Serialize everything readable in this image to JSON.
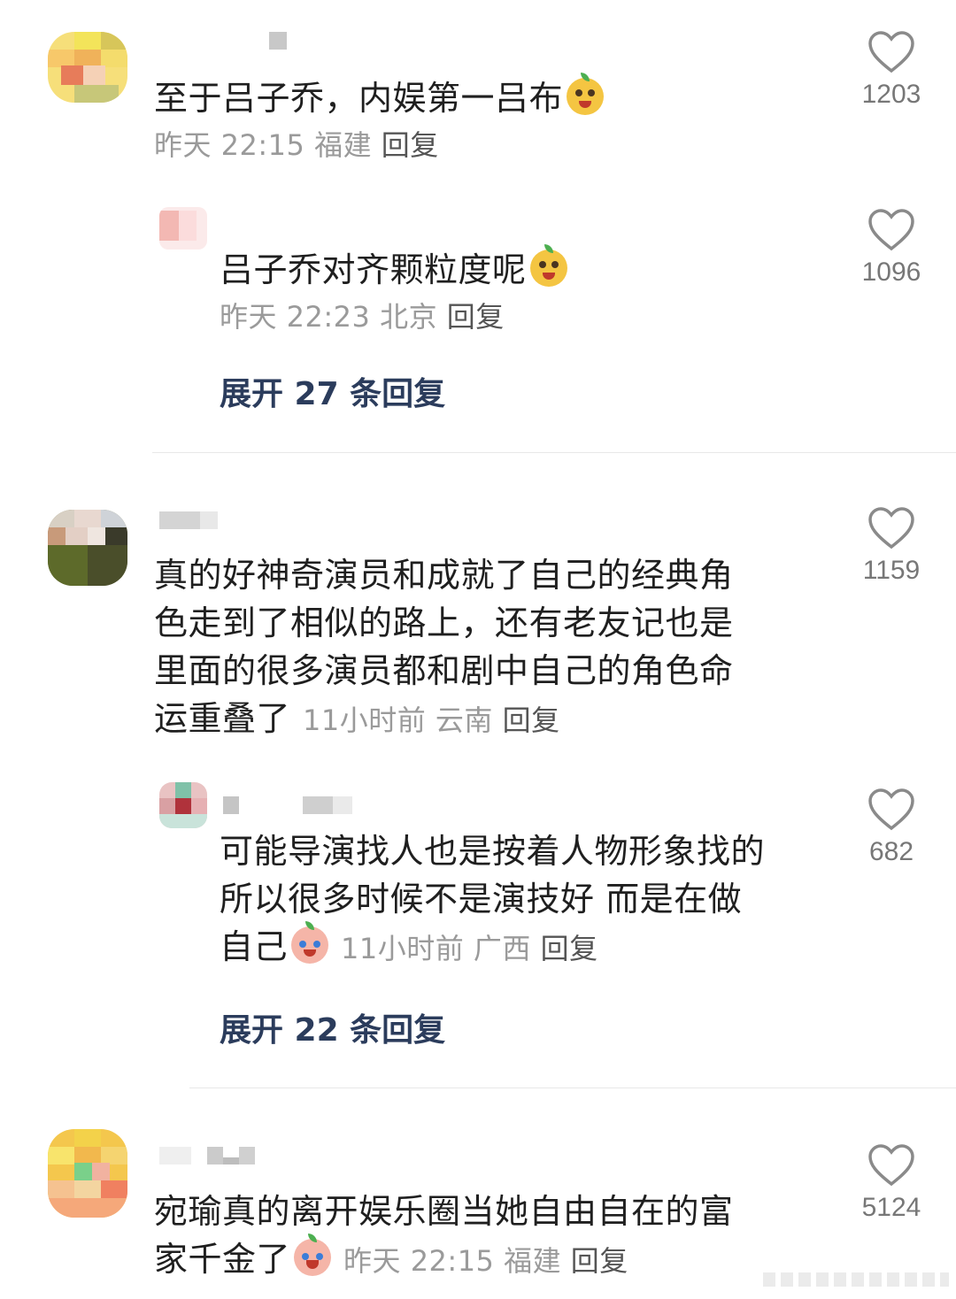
{
  "comments": [
    {
      "text": "至于吕子乔，内娱第一吕布",
      "emoji": "yellow-smile-emoji",
      "meta": "昨天 22:15 福建",
      "reply_label": "回复",
      "likes": "1203",
      "sub": {
        "text": "吕子乔对齐颗粒度呢",
        "emoji": "yellow-smile-emoji",
        "meta": "昨天 22:23 北京",
        "reply_label": "回复",
        "likes": "1096"
      },
      "expand": "展开 27 条回复"
    },
    {
      "text_lines": [
        "真的好神奇演员和成就了自己的经典角",
        "色走到了相似的路上，还有老友记也是",
        "里面的很多演员都和剧中自己的角色命",
        "运重叠了"
      ],
      "meta": "11小时前  云南",
      "reply_label": "回复",
      "likes": "1159",
      "sub": {
        "text_lines": [
          "可能导演找人也是按着人物形象找的",
          "所以很多时候不是演技好 而是在做",
          "自己"
        ],
        "emoji": "crying-laugh-emoji",
        "meta": "11小时前  广西",
        "reply_label": "回复",
        "likes": "682"
      },
      "expand": "展开 22 条回复"
    },
    {
      "text_lines": [
        "宛瑜真的离开娱乐圈当她自由自在的富",
        "家千金了"
      ],
      "emoji": "crying-emoji",
      "meta": "昨天 22:15 福建",
      "reply_label": "回复",
      "likes": "5124"
    }
  ],
  "icons": {
    "like": "heart-outline-icon"
  },
  "colors": {
    "expand": "#2b3c5c",
    "meta": "#9a9a9a",
    "text": "#1f1f1f"
  }
}
